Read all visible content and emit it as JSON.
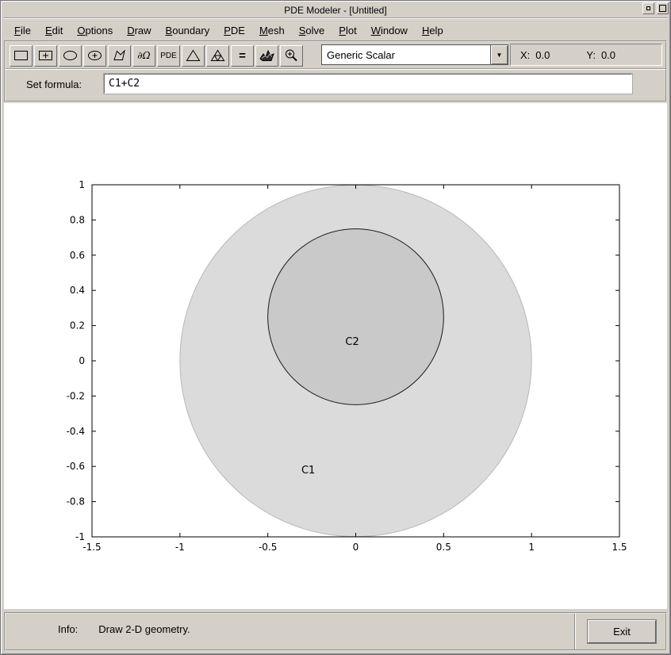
{
  "window": {
    "title": "PDE Modeler - [Untitled]"
  },
  "menu": {
    "items": [
      "File",
      "Edit",
      "Options",
      "Draw",
      "Boundary",
      "PDE",
      "Mesh",
      "Solve",
      "Plot",
      "Window",
      "Help"
    ]
  },
  "toolbar": {
    "boundary_label": "∂Ω",
    "pde_label": "PDE",
    "solve_label": "=",
    "dropdown": {
      "value": "Generic Scalar",
      "arrow": "▼"
    },
    "coordinates": {
      "x_label": "X:",
      "x_value": "0.0",
      "y_label": "Y:",
      "y_value": "0.0"
    },
    "icon_names": [
      "rectangle-icon",
      "rectangle-center-icon",
      "ellipse-icon",
      "ellipse-center-icon",
      "polygon-icon",
      "boundary-mode-label",
      "pde-mode-label",
      "initialize-mesh-icon",
      "refine-mesh-icon",
      "solve-equals-label",
      "plot-solution-icon",
      "zoom-icon"
    ]
  },
  "formula_bar": {
    "label": "Set formula:",
    "value": "C1+C2"
  },
  "status_bar": {
    "info_label": "Info:",
    "message": "Draw 2-D geometry.",
    "exit_label": "Exit"
  },
  "colors": {
    "chrome": "#d4d0c8",
    "canvas": "#ffffff",
    "axes_stroke": "#000000"
  },
  "chart_data": {
    "type": "geometry",
    "title": "",
    "xlabel": "",
    "ylabel": "",
    "xlim": [
      -1.5,
      1.5
    ],
    "ylim": [
      -1,
      1
    ],
    "xticks": [
      -1.5,
      -1,
      -0.5,
      0,
      0.5,
      1,
      1.5
    ],
    "yticks": [
      -1,
      -0.8,
      -0.6,
      -0.4,
      -0.2,
      0,
      0.2,
      0.4,
      0.6,
      0.8,
      1
    ],
    "grid": false,
    "shapes": [
      {
        "type": "circle",
        "label": "C1",
        "center": [
          0,
          0
        ],
        "radius": 1,
        "fill": "#dbdbdb",
        "stroke": "#b8b8b8",
        "label_pos": [
          -0.27,
          -0.64
        ]
      },
      {
        "type": "circle",
        "label": "C2",
        "center": [
          0,
          0.25
        ],
        "radius": 0.5,
        "fill": "#c9c9c9",
        "stroke": "#1a1a1a",
        "label_pos": [
          -0.02,
          0.09
        ]
      }
    ]
  }
}
